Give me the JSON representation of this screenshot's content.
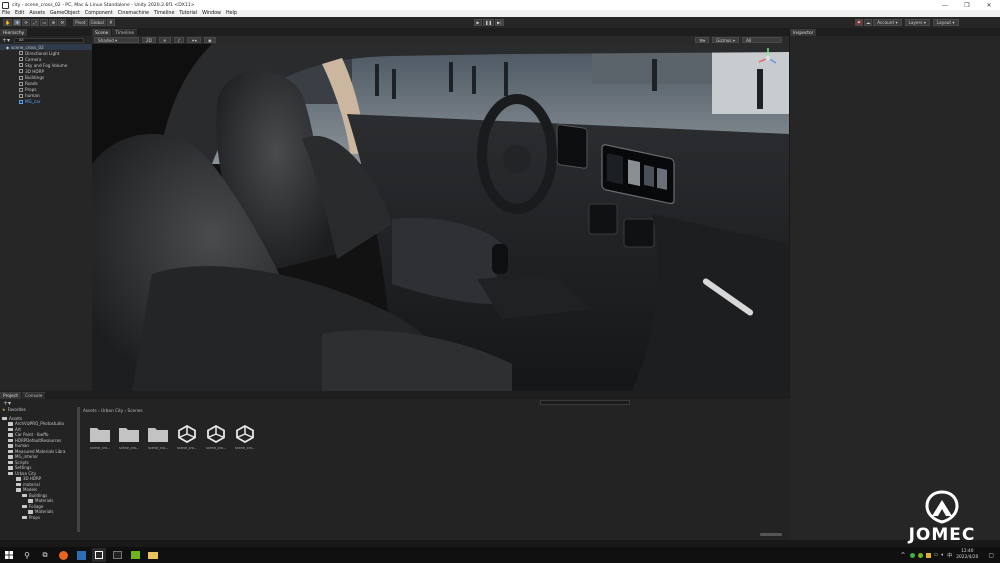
{
  "window": {
    "title": "city - scene_cross_02 - PC, Mac & Linux Standalone - Unity 2020.2.6f1 <DX11>"
  },
  "menu": [
    "File",
    "Edit",
    "Assets",
    "GameObject",
    "Component",
    "Cinemachine",
    "Timeline",
    "Tutorial",
    "Window",
    "Help"
  ],
  "toolbar": {
    "pivot_label": "Pivot",
    "global_label": "Global",
    "account_label": "Account",
    "layers_label": "Layers",
    "layout_label": "Layout"
  },
  "hierarchy": {
    "tab_label": "Hierarchy",
    "search_placeholder": "All",
    "items": [
      {
        "label": "scene_cross_02",
        "depth": 0,
        "root": true
      },
      {
        "label": "Directional Light",
        "depth": 2
      },
      {
        "label": "Camera",
        "depth": 2
      },
      {
        "label": "Sky and Fog Volume",
        "depth": 2
      },
      {
        "label": "3D HDRP",
        "depth": 2
      },
      {
        "label": "Buildings",
        "depth": 2
      },
      {
        "label": "Roads",
        "depth": 2
      },
      {
        "label": "Props",
        "depth": 2
      },
      {
        "label": "human",
        "depth": 2
      },
      {
        "label": "MG_car",
        "depth": 2,
        "blue": true
      }
    ]
  },
  "scene": {
    "tab_scene": "Scene",
    "tab_timeline": "Timeline",
    "shading_mode": "Shaded",
    "mode_2d": "2D",
    "gizmos_label": "Gizmos",
    "gizmo_search": "All"
  },
  "inspector": {
    "tab_label": "Inspector"
  },
  "project": {
    "tab_project": "Project",
    "tab_console": "Console",
    "favorites_label": "Favorites",
    "assets_label": "Assets",
    "tree": [
      {
        "label": "ArchVizPRO_Photostudio",
        "depth": 1
      },
      {
        "label": "Art",
        "depth": 1
      },
      {
        "label": "Car Paint - Ibeffo",
        "depth": 1
      },
      {
        "label": "HDRPDefaultResources",
        "depth": 1
      },
      {
        "label": "human",
        "depth": 1
      },
      {
        "label": "Measured Materials Libra",
        "depth": 1
      },
      {
        "label": "MG_interior",
        "depth": 1
      },
      {
        "label": "Scripts",
        "depth": 1
      },
      {
        "label": "Settings",
        "depth": 1
      },
      {
        "label": "Urban City",
        "depth": 1
      },
      {
        "label": "3D HDRP",
        "depth": 2
      },
      {
        "label": "material",
        "depth": 2
      },
      {
        "label": "Models",
        "depth": 2
      },
      {
        "label": "Buildings",
        "depth": 3
      },
      {
        "label": "Materials",
        "depth": 4
      },
      {
        "label": "Foliage",
        "depth": 3
      },
      {
        "label": "Materials",
        "depth": 4
      },
      {
        "label": "Props",
        "depth": 3
      }
    ],
    "breadcrumb": [
      "Assets",
      "Urban City",
      "Scenes"
    ],
    "assets": [
      {
        "label": "scene_cro...",
        "kind": "folder"
      },
      {
        "label": "scene_cro...",
        "kind": "folder"
      },
      {
        "label": "scene_cro...",
        "kind": "folder"
      },
      {
        "label": "scene_cro...",
        "kind": "unity"
      },
      {
        "label": "scene_cro...",
        "kind": "unity"
      },
      {
        "label": "scene_cro...",
        "kind": "unity"
      }
    ]
  },
  "taskbar": {
    "time": "12:40",
    "date": "2022/4/20",
    "ime": "中"
  },
  "watermark": {
    "text": "JOMEC"
  }
}
